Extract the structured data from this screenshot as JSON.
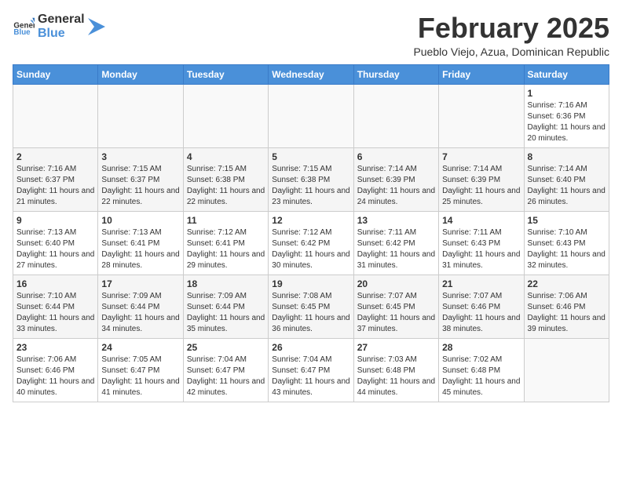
{
  "header": {
    "logo_general": "General",
    "logo_blue": "Blue",
    "month": "February 2025",
    "location": "Pueblo Viejo, Azua, Dominican Republic"
  },
  "weekdays": [
    "Sunday",
    "Monday",
    "Tuesday",
    "Wednesday",
    "Thursday",
    "Friday",
    "Saturday"
  ],
  "weeks": [
    [
      {
        "day": "",
        "info": ""
      },
      {
        "day": "",
        "info": ""
      },
      {
        "day": "",
        "info": ""
      },
      {
        "day": "",
        "info": ""
      },
      {
        "day": "",
        "info": ""
      },
      {
        "day": "",
        "info": ""
      },
      {
        "day": "1",
        "info": "Sunrise: 7:16 AM\nSunset: 6:36 PM\nDaylight: 11 hours and 20 minutes."
      }
    ],
    [
      {
        "day": "2",
        "info": "Sunrise: 7:16 AM\nSunset: 6:37 PM\nDaylight: 11 hours and 21 minutes."
      },
      {
        "day": "3",
        "info": "Sunrise: 7:15 AM\nSunset: 6:37 PM\nDaylight: 11 hours and 22 minutes."
      },
      {
        "day": "4",
        "info": "Sunrise: 7:15 AM\nSunset: 6:38 PM\nDaylight: 11 hours and 22 minutes."
      },
      {
        "day": "5",
        "info": "Sunrise: 7:15 AM\nSunset: 6:38 PM\nDaylight: 11 hours and 23 minutes."
      },
      {
        "day": "6",
        "info": "Sunrise: 7:14 AM\nSunset: 6:39 PM\nDaylight: 11 hours and 24 minutes."
      },
      {
        "day": "7",
        "info": "Sunrise: 7:14 AM\nSunset: 6:39 PM\nDaylight: 11 hours and 25 minutes."
      },
      {
        "day": "8",
        "info": "Sunrise: 7:14 AM\nSunset: 6:40 PM\nDaylight: 11 hours and 26 minutes."
      }
    ],
    [
      {
        "day": "9",
        "info": "Sunrise: 7:13 AM\nSunset: 6:40 PM\nDaylight: 11 hours and 27 minutes."
      },
      {
        "day": "10",
        "info": "Sunrise: 7:13 AM\nSunset: 6:41 PM\nDaylight: 11 hours and 28 minutes."
      },
      {
        "day": "11",
        "info": "Sunrise: 7:12 AM\nSunset: 6:41 PM\nDaylight: 11 hours and 29 minutes."
      },
      {
        "day": "12",
        "info": "Sunrise: 7:12 AM\nSunset: 6:42 PM\nDaylight: 11 hours and 30 minutes."
      },
      {
        "day": "13",
        "info": "Sunrise: 7:11 AM\nSunset: 6:42 PM\nDaylight: 11 hours and 31 minutes."
      },
      {
        "day": "14",
        "info": "Sunrise: 7:11 AM\nSunset: 6:43 PM\nDaylight: 11 hours and 31 minutes."
      },
      {
        "day": "15",
        "info": "Sunrise: 7:10 AM\nSunset: 6:43 PM\nDaylight: 11 hours and 32 minutes."
      }
    ],
    [
      {
        "day": "16",
        "info": "Sunrise: 7:10 AM\nSunset: 6:44 PM\nDaylight: 11 hours and 33 minutes."
      },
      {
        "day": "17",
        "info": "Sunrise: 7:09 AM\nSunset: 6:44 PM\nDaylight: 11 hours and 34 minutes."
      },
      {
        "day": "18",
        "info": "Sunrise: 7:09 AM\nSunset: 6:44 PM\nDaylight: 11 hours and 35 minutes."
      },
      {
        "day": "19",
        "info": "Sunrise: 7:08 AM\nSunset: 6:45 PM\nDaylight: 11 hours and 36 minutes."
      },
      {
        "day": "20",
        "info": "Sunrise: 7:07 AM\nSunset: 6:45 PM\nDaylight: 11 hours and 37 minutes."
      },
      {
        "day": "21",
        "info": "Sunrise: 7:07 AM\nSunset: 6:46 PM\nDaylight: 11 hours and 38 minutes."
      },
      {
        "day": "22",
        "info": "Sunrise: 7:06 AM\nSunset: 6:46 PM\nDaylight: 11 hours and 39 minutes."
      }
    ],
    [
      {
        "day": "23",
        "info": "Sunrise: 7:06 AM\nSunset: 6:46 PM\nDaylight: 11 hours and 40 minutes."
      },
      {
        "day": "24",
        "info": "Sunrise: 7:05 AM\nSunset: 6:47 PM\nDaylight: 11 hours and 41 minutes."
      },
      {
        "day": "25",
        "info": "Sunrise: 7:04 AM\nSunset: 6:47 PM\nDaylight: 11 hours and 42 minutes."
      },
      {
        "day": "26",
        "info": "Sunrise: 7:04 AM\nSunset: 6:47 PM\nDaylight: 11 hours and 43 minutes."
      },
      {
        "day": "27",
        "info": "Sunrise: 7:03 AM\nSunset: 6:48 PM\nDaylight: 11 hours and 44 minutes."
      },
      {
        "day": "28",
        "info": "Sunrise: 7:02 AM\nSunset: 6:48 PM\nDaylight: 11 hours and 45 minutes."
      },
      {
        "day": "",
        "info": ""
      }
    ]
  ]
}
